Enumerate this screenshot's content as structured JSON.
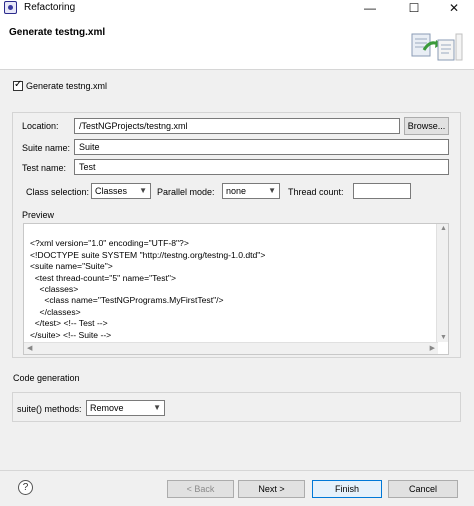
{
  "window": {
    "title": "Refactoring",
    "minimize": "—",
    "maximize": "☐",
    "close": "✕"
  },
  "header": {
    "title": "Generate testng.xml"
  },
  "generate_xml": {
    "label": "Generate testng.xml",
    "checked": true
  },
  "form": {
    "location_label": "Location:",
    "location_value": "/TestNGProjects/testng.xml",
    "browse_label": "Browse...",
    "suite_label": "Suite name:",
    "suite_value": "Suite",
    "test_label": "Test name:",
    "test_value": "Test",
    "class_selection_label": "Class selection:",
    "class_selection_value": "Classes",
    "parallel_label": "Parallel mode:",
    "parallel_value": "none",
    "thread_label": "Thread count:",
    "thread_value": ""
  },
  "preview": {
    "label": "Preview",
    "lines": [
      "<?xml version=\"1.0\" encoding=\"UTF-8\"?>",
      "<!DOCTYPE suite SYSTEM \"http://testng.org/testng-1.0.dtd\">",
      "<suite name=\"Suite\">",
      "  <test thread-count=\"5\" name=\"Test\">",
      "    <classes>",
      "      <class name=\"TestNGPrograms.MyFirstTest\"/>",
      "    </classes>",
      "  </test> <!-- Test -->",
      "</suite> <!-- Suite -->"
    ]
  },
  "code_generation": {
    "label": "Code generation",
    "suite_methods_label": "suite() methods:",
    "suite_methods_value": "Remove"
  },
  "footer": {
    "help_icon": "?",
    "back_label": "< Back",
    "next_label": "Next >",
    "finish_label": "Finish",
    "cancel_label": "Cancel"
  },
  "colors": {
    "focus_border": "#0078d7",
    "disabled_text": "#8a8a8a"
  }
}
